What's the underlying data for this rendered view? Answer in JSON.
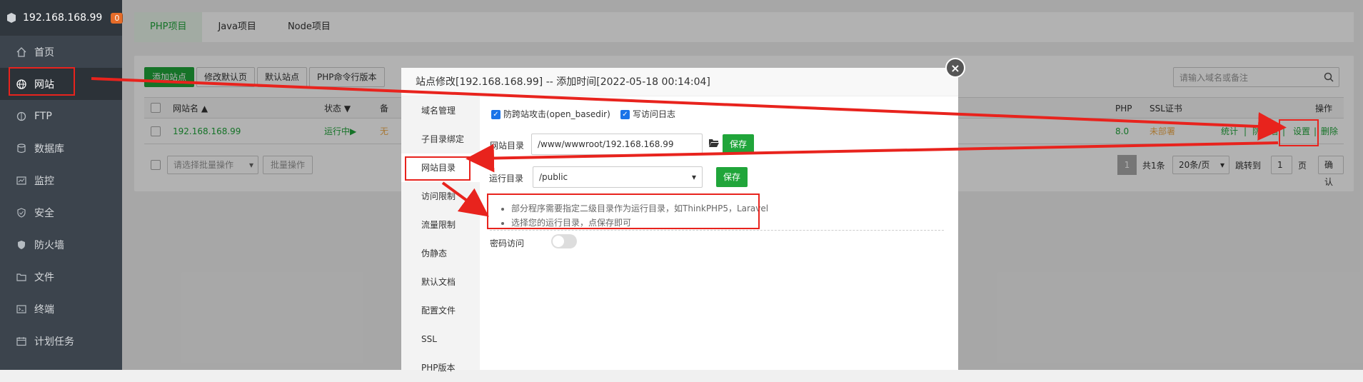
{
  "sidebar": {
    "host": "192.168.168.99",
    "badge": "0",
    "items": [
      {
        "label": "首页",
        "icon": "home-icon"
      },
      {
        "label": "网站",
        "icon": "globe-icon"
      },
      {
        "label": "FTP",
        "icon": "ftp-icon"
      },
      {
        "label": "数据库",
        "icon": "database-icon"
      },
      {
        "label": "监控",
        "icon": "monitor-icon"
      },
      {
        "label": "安全",
        "icon": "shield-icon"
      },
      {
        "label": "防火墙",
        "icon": "firewall-icon"
      },
      {
        "label": "文件",
        "icon": "folder-icon"
      },
      {
        "label": "终端",
        "icon": "terminal-icon"
      },
      {
        "label": "计划任务",
        "icon": "calendar-icon"
      }
    ]
  },
  "tabs": [
    "PHP项目",
    "Java项目",
    "Node项目"
  ],
  "toolbar": {
    "add_site": "添加站点",
    "edit_default_page": "修改默认页",
    "default_site": "默认站点",
    "php_cli": "PHP命令行版本"
  },
  "search": {
    "placeholder": "请输入域名或备注"
  },
  "table": {
    "headers": {
      "name": "网站名 ▲",
      "status": "状态 ▼",
      "remark": "备",
      "php": "PHP",
      "ssl": "SSL证书",
      "ops": "操作"
    },
    "row": {
      "name": "192.168.168.99",
      "status": "运行中▶",
      "remark": "无",
      "php": "8.0",
      "ssl": "未部署",
      "op_stats": "统计",
      "op_firewall": "防火墙",
      "op_settings": "设置",
      "op_delete": "删除",
      "sep": "|"
    }
  },
  "footer": {
    "batch_placeholder": "请选择批量操作",
    "batch_button": "批量操作",
    "page": "1",
    "total": "共1条",
    "per_page": "20条/页",
    "goto_label": "跳转到",
    "goto_value": "1",
    "page_unit": "页",
    "confirm": "确认"
  },
  "modal": {
    "title": "站点修改[192.168.168.99] -- 添加时间[2022-05-18 00:14:04]",
    "close": "×",
    "nav": [
      "域名管理",
      "子目录绑定",
      "网站目录",
      "访问限制",
      "流量限制",
      "伪静态",
      "默认文档",
      "配置文件",
      "SSL",
      "PHP版本"
    ],
    "anti_xss_label": "防跨站攻击(open_basedir)",
    "access_log_label": "写访问日志",
    "site_dir_label": "网站目录",
    "site_dir_value": "/www/wwwroot/192.168.168.99",
    "save": "保存",
    "run_dir_label": "运行目录",
    "run_dir_value": "/public",
    "tip1": "部分程序需要指定二级目录作为运行目录，如ThinkPHP5，Laravel",
    "tip2": "选择您的运行目录，点保存即可",
    "password_access_label": "密码访问"
  },
  "colors": {
    "brand_green": "#20a53a",
    "annotation_red": "#e8231d",
    "sidebar_bg": "#3c444d"
  }
}
